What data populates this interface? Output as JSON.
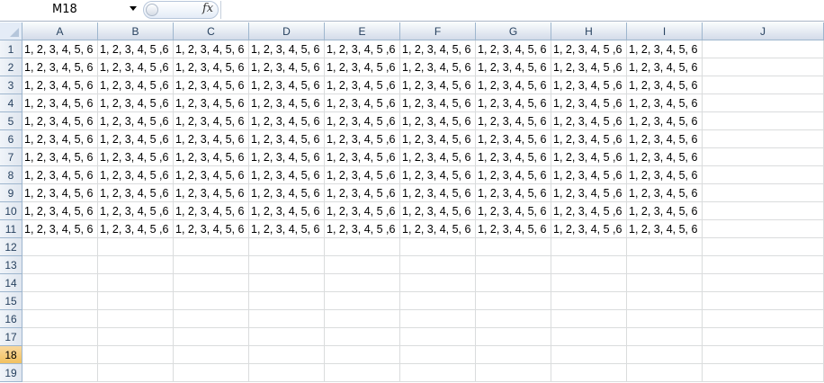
{
  "formula_bar": {
    "name_box": "M18",
    "fx_label": "fx",
    "formula": ""
  },
  "columns": [
    "A",
    "B",
    "C",
    "D",
    "E",
    "F",
    "G",
    "H",
    "I",
    "J"
  ],
  "rows": [
    {
      "label": "1",
      "cells": [
        "1, 2, 3, 4, 5, 6",
        "1, 2, 3, 4, 5 ,6",
        "1, 2, 3, 4, 5, 6",
        "1, 2, 3, 4, 5, 6",
        "1, 2, 3, 4, 5 ,6",
        "1, 2, 3, 4, 5, 6",
        "1, 2, 3, 4, 5, 6",
        "1, 2, 3, 4, 5 ,6",
        "1, 2, 3, 4, 5, 6",
        ""
      ]
    },
    {
      "label": "2",
      "cells": [
        "1, 2, 3, 4, 5, 6",
        "1, 2, 3, 4, 5 ,6",
        "1, 2, 3, 4, 5, 6",
        "1, 2, 3, 4, 5, 6",
        "1, 2, 3, 4, 5 ,6",
        "1, 2, 3, 4, 5, 6",
        "1, 2, 3, 4, 5, 6",
        "1, 2, 3, 4, 5 ,6",
        "1, 2, 3, 4, 5, 6",
        ""
      ]
    },
    {
      "label": "3",
      "cells": [
        "1, 2, 3, 4, 5, 6",
        "1, 2, 3, 4, 5 ,6",
        "1, 2, 3, 4, 5, 6",
        "1, 2, 3, 4, 5, 6",
        "1, 2, 3, 4, 5 ,6",
        "1, 2, 3, 4, 5, 6",
        "1, 2, 3, 4, 5, 6",
        "1, 2, 3, 4, 5 ,6",
        "1, 2, 3, 4, 5, 6",
        ""
      ]
    },
    {
      "label": "4",
      "cells": [
        "1, 2, 3, 4, 5, 6",
        "1, 2, 3, 4, 5 ,6",
        "1, 2, 3, 4, 5, 6",
        "1, 2, 3, 4, 5, 6",
        "1, 2, 3, 4, 5 ,6",
        "1, 2, 3, 4, 5, 6",
        "1, 2, 3, 4, 5, 6",
        "1, 2, 3, 4, 5 ,6",
        "1, 2, 3, 4, 5, 6",
        ""
      ]
    },
    {
      "label": "5",
      "cells": [
        "1, 2, 3, 4, 5, 6",
        "1, 2, 3, 4, 5 ,6",
        "1, 2, 3, 4, 5, 6",
        "1, 2, 3, 4, 5, 6",
        "1, 2, 3, 4, 5 ,6",
        "1, 2, 3, 4, 5, 6",
        "1, 2, 3, 4, 5, 6",
        "1, 2, 3, 4, 5 ,6",
        "1, 2, 3, 4, 5, 6",
        ""
      ]
    },
    {
      "label": "6",
      "cells": [
        "1, 2, 3, 4, 5, 6",
        "1, 2, 3, 4, 5 ,6",
        "1, 2, 3, 4, 5, 6",
        "1, 2, 3, 4, 5, 6",
        "1, 2, 3, 4, 5 ,6",
        "1, 2, 3, 4, 5, 6",
        "1, 2, 3, 4, 5, 6",
        "1, 2, 3, 4, 5 ,6",
        "1, 2, 3, 4, 5, 6",
        ""
      ]
    },
    {
      "label": "7",
      "cells": [
        "1, 2, 3, 4, 5, 6",
        "1, 2, 3, 4, 5 ,6",
        "1, 2, 3, 4, 5, 6",
        "1, 2, 3, 4, 5, 6",
        "1, 2, 3, 4, 5 ,6",
        "1, 2, 3, 4, 5, 6",
        "1, 2, 3, 4, 5, 6",
        "1, 2, 3, 4, 5 ,6",
        "1, 2, 3, 4, 5, 6",
        ""
      ]
    },
    {
      "label": "8",
      "cells": [
        "1, 2, 3, 4, 5, 6",
        "1, 2, 3, 4, 5 ,6",
        "1, 2, 3, 4, 5, 6",
        "1, 2, 3, 4, 5, 6",
        "1, 2, 3, 4, 5 ,6",
        "1, 2, 3, 4, 5, 6",
        "1, 2, 3, 4, 5, 6",
        "1, 2, 3, 4, 5 ,6",
        "1, 2, 3, 4, 5, 6",
        ""
      ]
    },
    {
      "label": "9",
      "cells": [
        "1, 2, 3, 4, 5, 6",
        "1, 2, 3, 4, 5 ,6",
        "1, 2, 3, 4, 5, 6",
        "1, 2, 3, 4, 5, 6",
        "1, 2, 3, 4, 5 ,6",
        "1, 2, 3, 4, 5, 6",
        "1, 2, 3, 4, 5, 6",
        "1, 2, 3, 4, 5 ,6",
        "1, 2, 3, 4, 5, 6",
        ""
      ]
    },
    {
      "label": "10",
      "cells": [
        "1, 2, 3, 4, 5, 6",
        "1, 2, 3, 4, 5 ,6",
        "1, 2, 3, 4, 5, 6",
        "1, 2, 3, 4, 5, 6",
        "1, 2, 3, 4, 5 ,6",
        "1, 2, 3, 4, 5, 6",
        "1, 2, 3, 4, 5, 6",
        "1, 2, 3, 4, 5 ,6",
        "1, 2, 3, 4, 5, 6",
        ""
      ]
    },
    {
      "label": "11",
      "cells": [
        "1, 2, 3, 4, 5, 6",
        "1, 2, 3, 4, 5 ,6",
        "1, 2, 3, 4, 5, 6",
        "1, 2, 3, 4, 5, 6",
        "1, 2, 3, 4, 5 ,6",
        "1, 2, 3, 4, 5, 6",
        "1, 2, 3, 4, 5, 6",
        "1, 2, 3, 4, 5 ,6",
        "1, 2, 3, 4, 5, 6",
        ""
      ]
    },
    {
      "label": "12",
      "cells": [
        "",
        "",
        "",
        "",
        "",
        "",
        "",
        "",
        "",
        ""
      ]
    },
    {
      "label": "13",
      "cells": [
        "",
        "",
        "",
        "",
        "",
        "",
        "",
        "",
        "",
        ""
      ]
    },
    {
      "label": "14",
      "cells": [
        "",
        "",
        "",
        "",
        "",
        "",
        "",
        "",
        "",
        ""
      ]
    },
    {
      "label": "15",
      "cells": [
        "",
        "",
        "",
        "",
        "",
        "",
        "",
        "",
        "",
        ""
      ]
    },
    {
      "label": "16",
      "cells": [
        "",
        "",
        "",
        "",
        "",
        "",
        "",
        "",
        "",
        ""
      ]
    },
    {
      "label": "17",
      "cells": [
        "",
        "",
        "",
        "",
        "",
        "",
        "",
        "",
        "",
        ""
      ]
    },
    {
      "label": "18",
      "cells": [
        "",
        "",
        "",
        "",
        "",
        "",
        "",
        "",
        "",
        ""
      ]
    },
    {
      "label": "19",
      "cells": [
        "",
        "",
        "",
        "",
        "",
        "",
        "",
        "",
        "",
        ""
      ]
    }
  ],
  "active_row": "18"
}
